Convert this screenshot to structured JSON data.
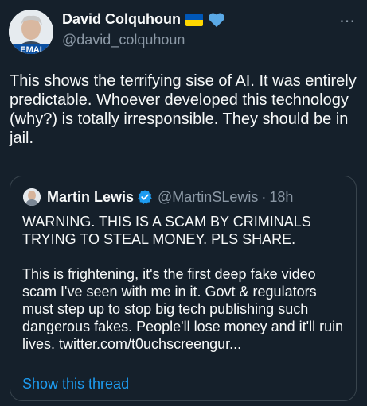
{
  "author": {
    "name": "David Colquhoun",
    "handle": "@david_colquhoun",
    "avatar_text": "EMAI",
    "flag_colors": [
      "#0057b7",
      "#ffd700"
    ],
    "heart_color": "#5aa9e6"
  },
  "more_icon": "⋯",
  "tweet": {
    "text": "This shows the terrifying sise of AI.  It was entirely predictable. Whoever developed this technology (why?) is totally irresponsible. They should be in jail."
  },
  "quoted": {
    "name": "Martin Lewis",
    "handle": "@MartinSLewis",
    "separator": "·",
    "time": "18h",
    "verified_color": "#1d9bf0",
    "text": "WARNING. THIS IS A SCAM BY CRIMINALS TRYING TO STEAL MONEY. PLS SHARE.\n\nThis is frightening, it's the first deep fake video scam I've seen with me in it. Govt & regulators must step up to stop big tech publishing such dangerous fakes. People'll lose money and it'll ruin lives. twitter.com/t0uchscreengur...",
    "show_thread": "Show this thread"
  },
  "colors": {
    "background": "#15202b",
    "text": "#f7f9f9",
    "secondary": "#8b98a5",
    "link": "#1d9bf0",
    "border": "#38444d"
  }
}
